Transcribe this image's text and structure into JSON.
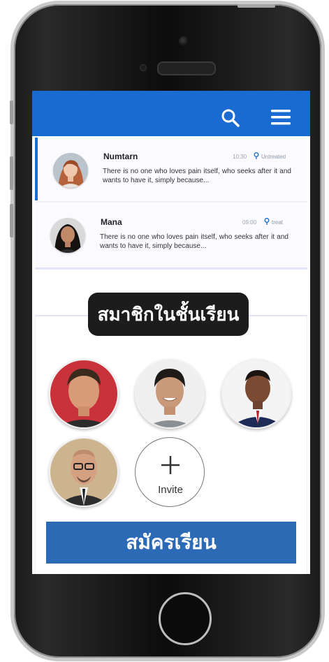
{
  "header": {
    "search_icon": "search-icon",
    "menu_icon": "hamburger-menu-icon",
    "bar_color": "#1a6bd1"
  },
  "messages": [
    {
      "name": "Numtarn",
      "time": "10:30",
      "status": "Untreated",
      "body": "There is no one who loves pain itself, who seeks after it and wants to have it, simply because...",
      "active": true
    },
    {
      "name": "Mana",
      "time": "09:00",
      "status": "treat",
      "body": "There is no one who loves pain itself, who seeks after it and wants to have it, simply because...",
      "active": false
    }
  ],
  "section": {
    "title": "สมาชิกในชั้นเรียน"
  },
  "members": {
    "invite_label": "Invite"
  },
  "register": {
    "label": "สมัครเรียน",
    "color": "#2c6ab6"
  }
}
